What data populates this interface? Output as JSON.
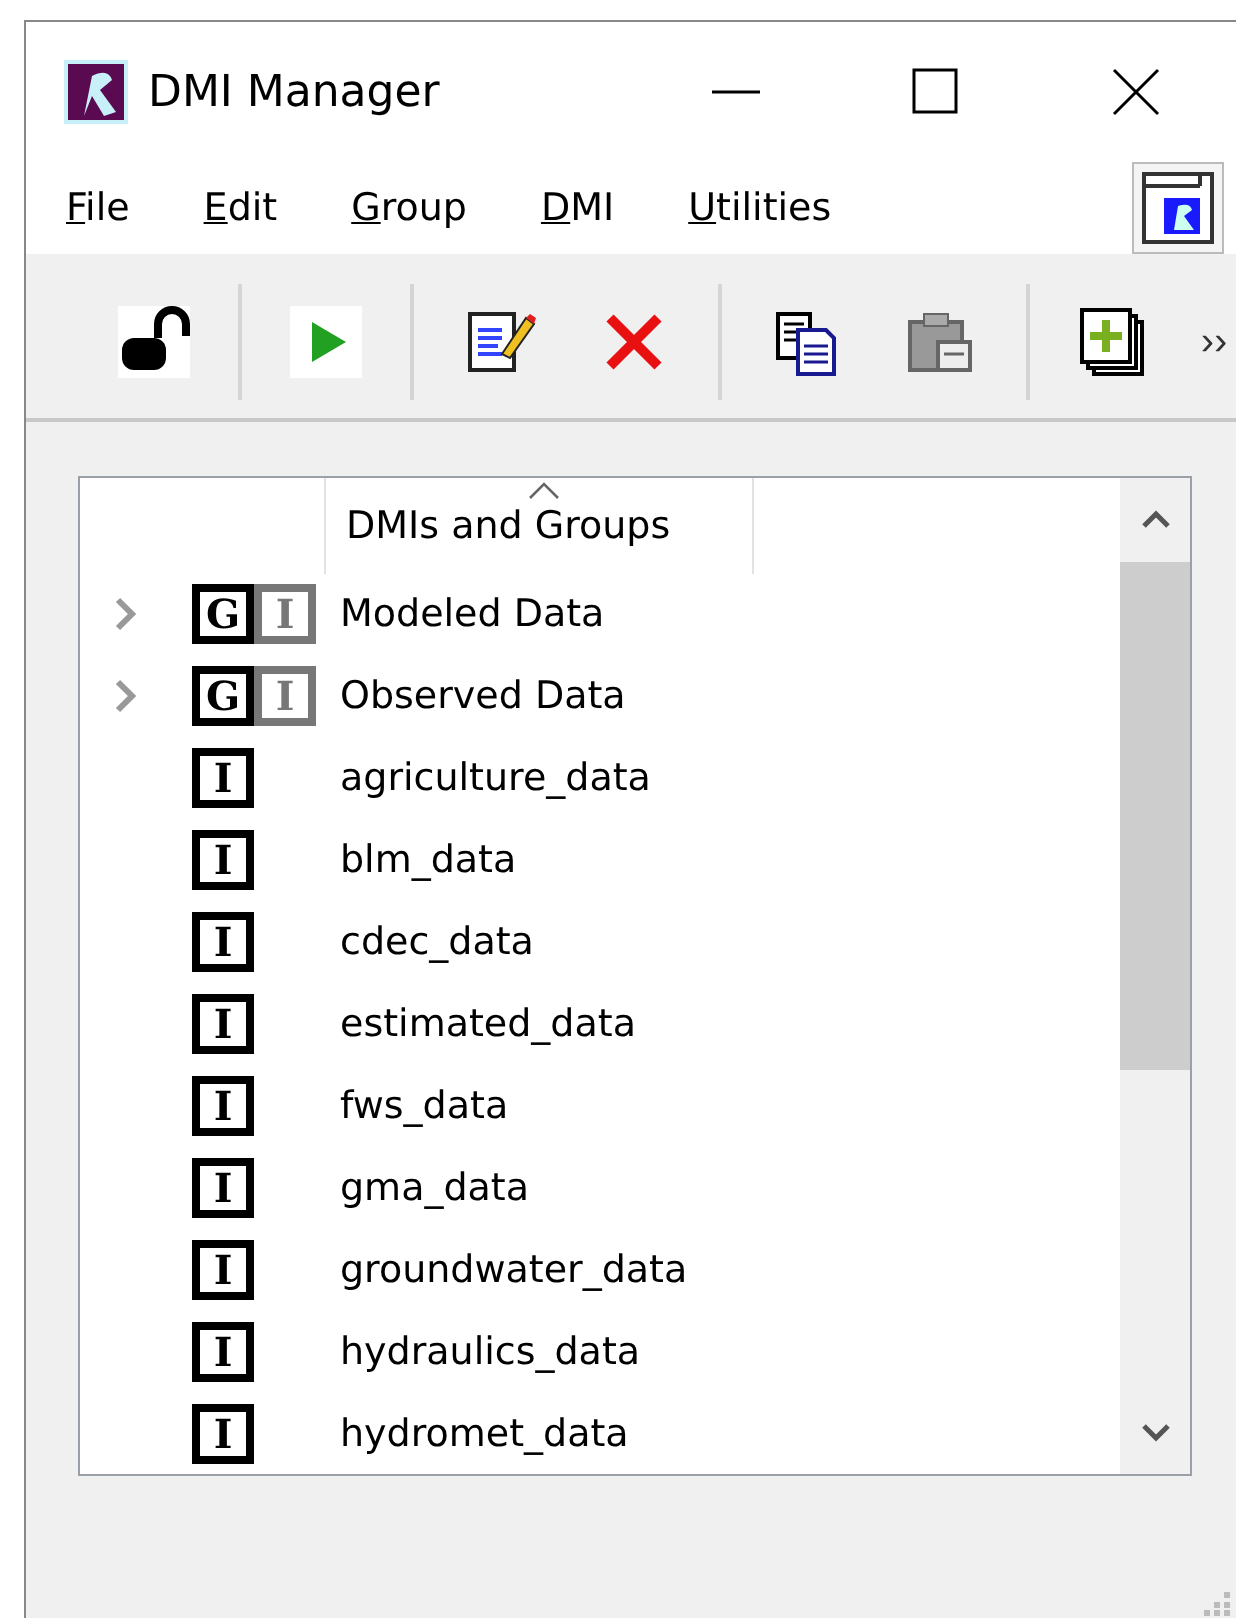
{
  "window": {
    "title": "DMI Manager"
  },
  "menu": [
    {
      "key": "F",
      "rest": "ile"
    },
    {
      "key": "E",
      "rest": "dit"
    },
    {
      "key": "G",
      "rest": "roup"
    },
    {
      "key": "D",
      "rest": "MI"
    },
    {
      "key": "U",
      "rest": "tilities"
    }
  ],
  "toolbar": {
    "overflow": "››"
  },
  "tree": {
    "columns": [
      "DMIs and Groups"
    ],
    "items": [
      {
        "kind": "group",
        "label": "Modeled Data",
        "expanded": false,
        "badges": [
          {
            "text": "G",
            "disabled": false
          },
          {
            "text": "I",
            "disabled": true
          }
        ]
      },
      {
        "kind": "group",
        "label": "Observed Data",
        "expanded": false,
        "badges": [
          {
            "text": "G",
            "disabled": false
          },
          {
            "text": "I",
            "disabled": true
          }
        ]
      },
      {
        "kind": "dmi",
        "label": "agriculture_data",
        "badges": [
          {
            "text": "I",
            "disabled": false
          }
        ]
      },
      {
        "kind": "dmi",
        "label": "blm_data",
        "badges": [
          {
            "text": "I",
            "disabled": false
          }
        ]
      },
      {
        "kind": "dmi",
        "label": "cdec_data",
        "badges": [
          {
            "text": "I",
            "disabled": false
          }
        ]
      },
      {
        "kind": "dmi",
        "label": "estimated_data",
        "badges": [
          {
            "text": "I",
            "disabled": false
          }
        ]
      },
      {
        "kind": "dmi",
        "label": "fws_data",
        "badges": [
          {
            "text": "I",
            "disabled": false
          }
        ]
      },
      {
        "kind": "dmi",
        "label": "gma_data",
        "badges": [
          {
            "text": "I",
            "disabled": false
          }
        ]
      },
      {
        "kind": "dmi",
        "label": "groundwater_data",
        "badges": [
          {
            "text": "I",
            "disabled": false
          }
        ]
      },
      {
        "kind": "dmi",
        "label": "hydraulics_data",
        "badges": [
          {
            "text": "I",
            "disabled": false
          }
        ]
      },
      {
        "kind": "dmi",
        "label": "hydromet_data",
        "badges": [
          {
            "text": "I",
            "disabled": false
          }
        ]
      }
    ]
  }
}
